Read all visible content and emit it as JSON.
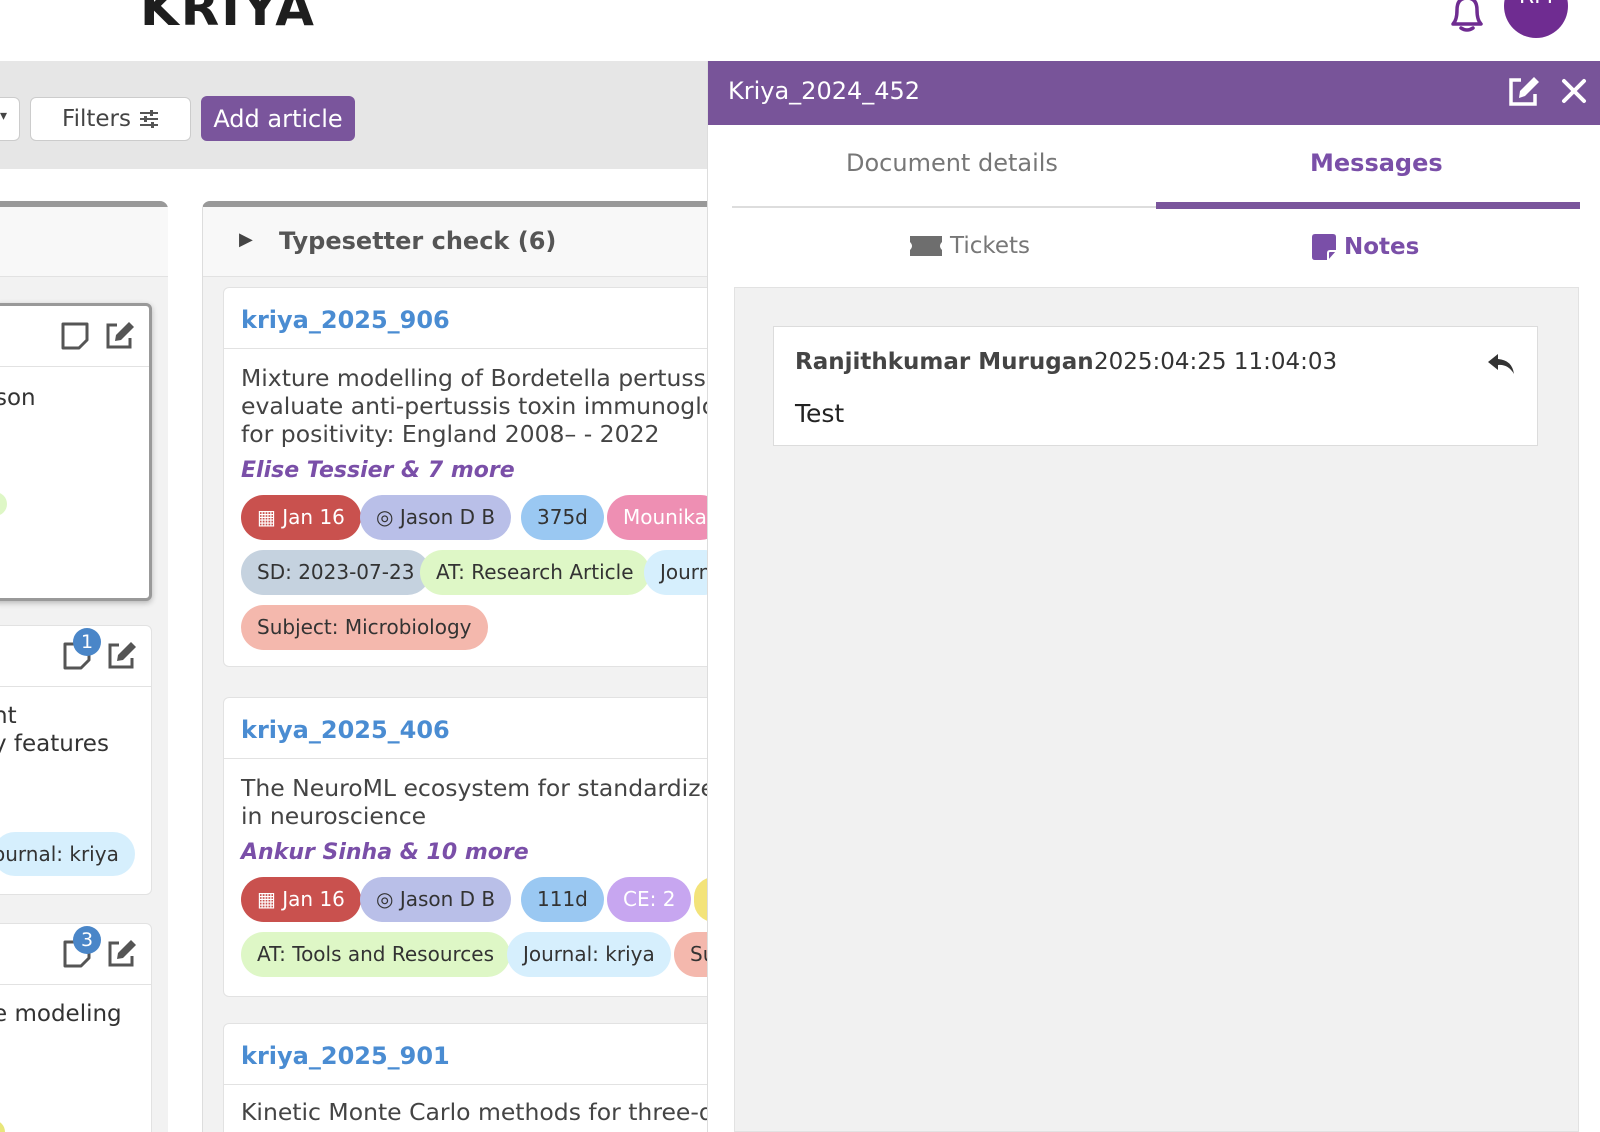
{
  "header": {
    "logo": "KRIYA",
    "avatar_initials": "RM"
  },
  "toolbar": {
    "filters_label": "Filters",
    "add_article_label": "Add article"
  },
  "left_column": {
    "cards": [
      {
        "text": "son",
        "has_green_dot": true
      },
      {
        "text": "nt\ny features",
        "badge": "1",
        "tag": "ournal: kriya"
      },
      {
        "text": "e modeling",
        "badge": "3"
      }
    ]
  },
  "main_column": {
    "title": "Typesetter check (6)",
    "cards": [
      {
        "id": "kriya_2025_906",
        "title_lines": [
          "Mixture modelling of Bordetella pertussis",
          "evaluate anti-pertussis toxin immunoglob",
          "for positivity: England 2008– - 2022"
        ],
        "authors": "Elise Tessier & 7 more",
        "tags_row1": {
          "date": "Jan 16",
          "user": "Jason D B",
          "days": "375d",
          "extra": "Mounika"
        },
        "tags_row2": {
          "sd": "SD: 2023-07-23",
          "at": "AT: Research Article",
          "journal": "Journ"
        },
        "tags_row3": {
          "subject": "Subject: Microbiology"
        }
      },
      {
        "id": "kriya_2025_406",
        "title_lines": [
          "The NeuroML ecosystem for standardized",
          "in neuroscience"
        ],
        "authors": "Ankur Sinha & 10 more",
        "tags_row1": {
          "date": "Jan 16",
          "user": "Jason D B",
          "days": "111d",
          "ce": "CE: 2"
        },
        "tags_row2": {
          "at": "AT: Tools and Resources",
          "journal": "Journal: kriya",
          "subject": "Su"
        }
      },
      {
        "id": "kriya_2025_901",
        "title_lines": [
          "Kinetic Monte Carlo methods for three-dir"
        ]
      }
    ]
  },
  "panel": {
    "title": "Kriya_2024_452",
    "tabs": [
      "Document details",
      "Messages"
    ],
    "active_tab": "Messages",
    "subtabs": [
      "Tickets",
      "Notes"
    ],
    "active_subtab": "Notes",
    "notes": [
      {
        "author": "Ranjithkumar Murugan",
        "timestamp": "2025:04:25 11:04:03",
        "body": "Test"
      }
    ]
  },
  "colors": {
    "brand_purple": "#785499",
    "link_blue": "#4a8cd2",
    "date_red": "#c9514e"
  }
}
